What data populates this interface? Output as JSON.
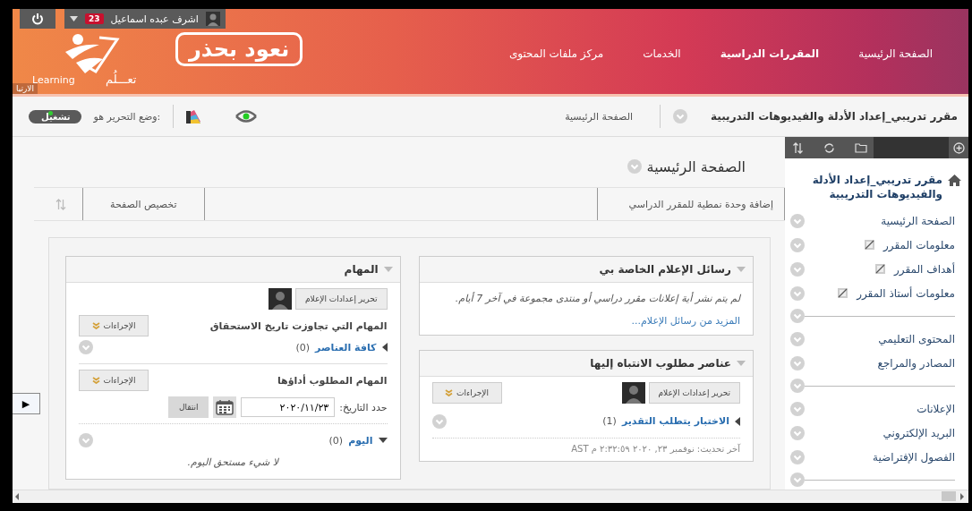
{
  "top_bar": {
    "user_name": "اشرف عبده اسماعيل",
    "notification_count": "23"
  },
  "header": {
    "logo_text": "نعود بحذر",
    "brand_arabic": "تعـــلُم",
    "brand_latin": "Learning",
    "side_tab": "الارتبا",
    "nav": [
      {
        "label": "الصفحة الرئيسية",
        "selected": false
      },
      {
        "label": "المقررات الدراسية",
        "selected": true
      },
      {
        "label": "الخدمات",
        "selected": false
      },
      {
        "label": "مركز ملفات المحتوى",
        "selected": false
      }
    ]
  },
  "breadcrumb": {
    "course": "مقرر تدريبي_إعداد الأدلة والفيديوهات التدريبية",
    "page": "الصفحة الرئيسية",
    "edit_mode_label": "وضع التحرير هو:",
    "edit_mode": {
      "label": "تشغيل",
      "on": true
    }
  },
  "sidebar": {
    "course_title": "مقرر تدريبي_إعداد الأدلة والفيديوهات التدريبية",
    "items": [
      {
        "kind": "link",
        "label": "الصفحة الرئيسية",
        "hidden_marker": false
      },
      {
        "kind": "link",
        "label": "معلومات المقرر",
        "hidden_marker": true
      },
      {
        "kind": "link",
        "label": "أهداف المقرر",
        "hidden_marker": true
      },
      {
        "kind": "link",
        "label": "معلومات أستاذ المقرر",
        "hidden_marker": true
      },
      {
        "kind": "divider"
      },
      {
        "kind": "link",
        "label": "المحتوى التعليمي",
        "hidden_marker": false
      },
      {
        "kind": "link",
        "label": "المصادر والمراجع",
        "hidden_marker": false
      },
      {
        "kind": "divider"
      },
      {
        "kind": "link",
        "label": "الإعلانات",
        "hidden_marker": false
      },
      {
        "kind": "link",
        "label": "البريد الإلكتروني",
        "hidden_marker": false
      },
      {
        "kind": "link",
        "label": "الفصول الإفتراضية",
        "hidden_marker": false
      },
      {
        "kind": "divider"
      }
    ]
  },
  "page": {
    "title": "الصفحة الرئيسية",
    "add_module": "إضافة وحدة نمطية للمقرر الدراسي",
    "customize": "تخصيص الصفحة",
    "menu_toggle": "▶"
  },
  "announcements": {
    "title": "رسائل الإعلام الخاصة بي",
    "message": "لم يتم نشر أية إعلانات مقرر دراسي أو منتدى مجموعة في آخر 7 أيام.",
    "more_link": "المزيد من رسائل الإعلام..."
  },
  "needs_attention": {
    "title": "عناصر مطلوب الانتباه إليها",
    "settings_button": "تحرير إعدادات الإعلام",
    "actions_button": "الإجراءات",
    "group": {
      "label": "الاختبار يتطلب التقدير",
      "count": "(1)",
      "expanded": false
    },
    "updated": "آخر تحديث: نوفمبر ٢٣, ٢٠٢٠ ٢:٣٢:٥٩ م AST"
  },
  "tasks": {
    "title": "المهام",
    "settings_button": "تحرير إعدادات الإعلام",
    "sections": [
      {
        "heading": "المهام التي تجاوزت تاريخ الاستحقاق",
        "actions_button": "الإجراءات",
        "group": {
          "label": "كافة العناصر",
          "count": "(0)",
          "expanded": false
        }
      },
      {
        "heading": "المهام المطلوب أداؤها",
        "actions_button": "الإجراءات",
        "date_label": "حدد التاريخ:",
        "date_value": "٢٠٢٠/١١/٢٣",
        "go_button": "انتقال",
        "group": {
          "label": "اليوم",
          "count": "(0)",
          "expanded": true
        },
        "empty": "لا شيء مستحق اليوم."
      }
    ]
  }
}
